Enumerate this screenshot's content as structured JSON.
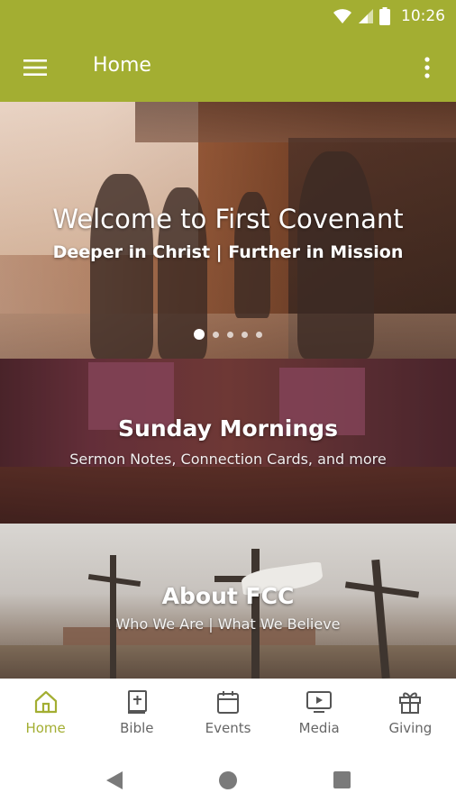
{
  "status_bar": {
    "time": "10:26"
  },
  "app_bar": {
    "title": "Home"
  },
  "hero": {
    "title": "Welcome to First Covenant",
    "subtitle": "Deeper in Christ | Further in Mission",
    "slide_count": 5,
    "active_slide": 1
  },
  "tiles": [
    {
      "title": "Sunday Mornings",
      "subtitle": "Sermon Notes, Connection Cards, and more"
    },
    {
      "title": "About FCC",
      "subtitle": "Who We Are | What We Believe"
    }
  ],
  "bottom_nav": [
    {
      "label": "Home",
      "icon": "home-icon",
      "active": true
    },
    {
      "label": "Bible",
      "icon": "bible-icon",
      "active": false
    },
    {
      "label": "Events",
      "icon": "calendar-icon",
      "active": false
    },
    {
      "label": "Media",
      "icon": "media-icon",
      "active": false
    },
    {
      "label": "Giving",
      "icon": "gift-icon",
      "active": false
    }
  ],
  "colors": {
    "accent": "#a3ae32",
    "nav_inactive": "#666666"
  }
}
